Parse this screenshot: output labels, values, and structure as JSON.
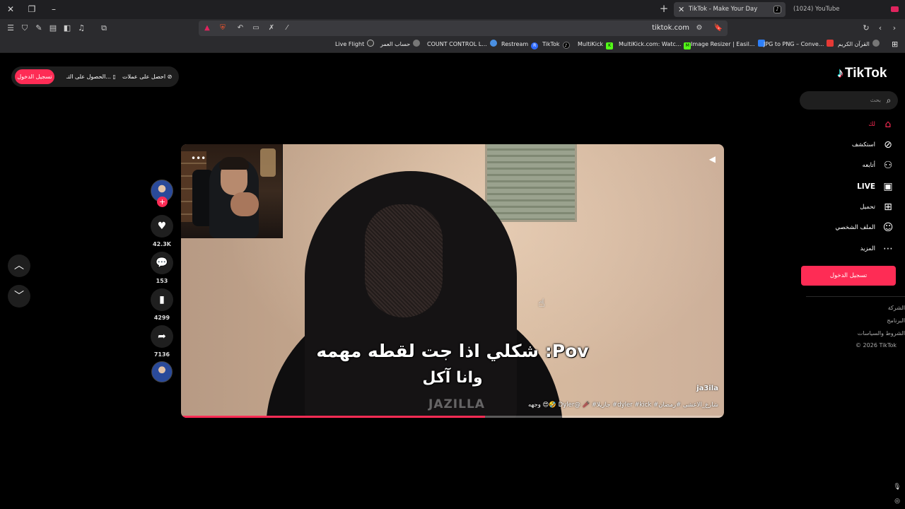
{
  "browser": {
    "tabs": [
      {
        "title": "TikTok - Make Your Day",
        "active": true
      },
      {
        "title": "(1024) YouTube",
        "active": false
      }
    ],
    "url": "tiktok.com",
    "shields_badge": "5",
    "bookmarks": [
      "Live Flight",
      "حساب العمر",
      "COUNT CONTROL L...",
      "Restream",
      "TikTok",
      "MultiKick",
      "MultiKick.com: Watc...",
      "Image Resizer | Easil...",
      "JPG to PNG – Conve...",
      "القرآن الكريم"
    ]
  },
  "topbar": {
    "login": "تسجيل الدخول",
    "get_app": "الحصول على التـ...",
    "get_coins": "احصل على عملات"
  },
  "logo": "TikTok",
  "search": {
    "placeholder": "بحث"
  },
  "nav": [
    {
      "label": "لك",
      "icon": "home-icon"
    },
    {
      "label": "استكشف",
      "icon": "compass-icon"
    },
    {
      "label": "أتابعه",
      "icon": "following-icon"
    },
    {
      "label": "LIVE",
      "icon": "live-icon"
    },
    {
      "label": "تحميل",
      "icon": "upload-icon"
    },
    {
      "label": "الملف الشخصي",
      "icon": "profile-icon"
    },
    {
      "label": "المزيد",
      "icon": "more-icon"
    }
  ],
  "side_login": "تسجيل الدخول",
  "footer": [
    "الشركة",
    "البرنامج",
    "الشروط والسياسات",
    "© 2026 TikTok"
  ],
  "video": {
    "subtitle_line1": "شكلي اذا جت لقطه مهمه :Pov",
    "subtitle_line2": "وانا آكل",
    "watermark": "JAZILLA",
    "author": "ja3ila",
    "caption": "وجهه 😍🤣 Dyler@ 🥢 #جازيلا #dyler #kick #شارع_الاعشى #رمضان",
    "progress": 0.56
  },
  "actions": {
    "likes": "42.3K",
    "comments": "153",
    "saves": "4299",
    "shares": "7136"
  },
  "colors": {
    "accent": "#fe2c55",
    "background": "#000000"
  }
}
